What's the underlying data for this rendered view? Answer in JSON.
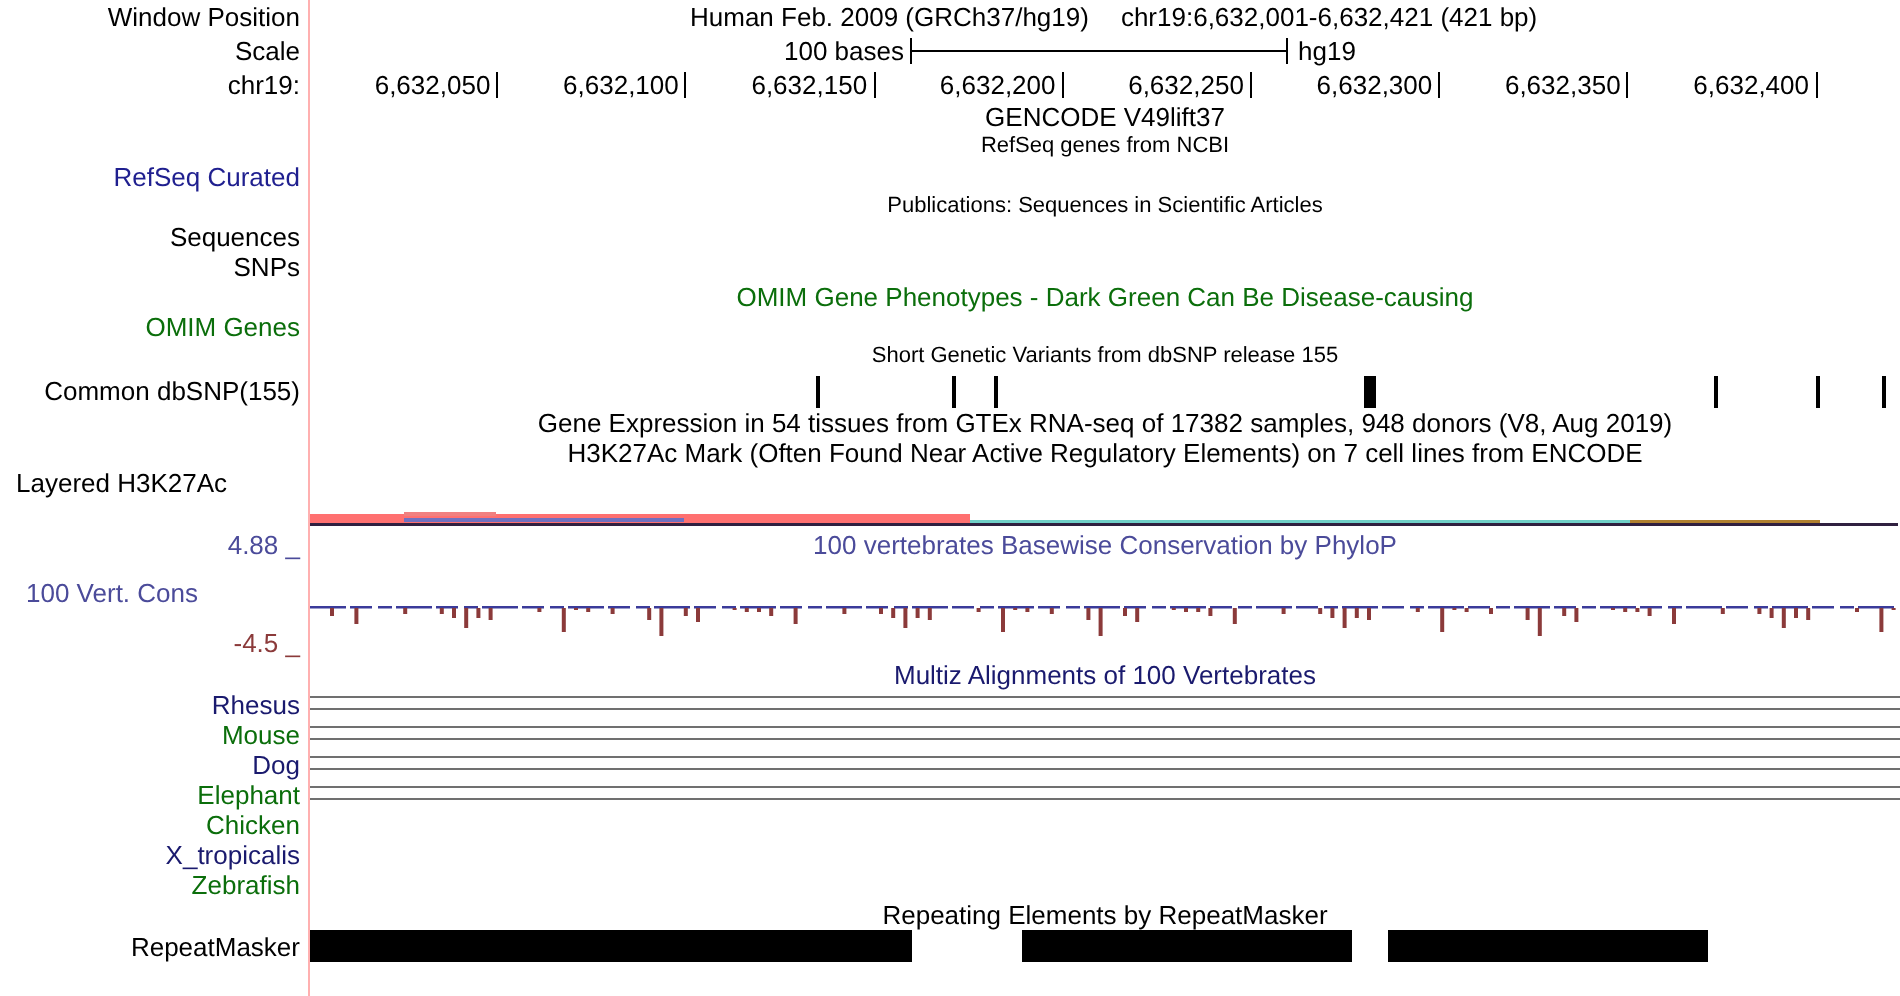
{
  "header": {
    "position_label": "Window Position",
    "assembly": "Human Feb. 2009 (GRCh37/hg19)",
    "position": "chr19:6,632,001-6,632,421 (421 bp)",
    "scale_label": "Scale",
    "scale_text": "100 bases",
    "scale_db": "hg19",
    "ruler_label": "chr19:",
    "ruler_ticks": [
      "6,632,050",
      "6,632,100",
      "6,632,150",
      "6,632,200",
      "6,632,250",
      "6,632,300",
      "6,632,350",
      "6,632,400"
    ]
  },
  "tracks": [
    {
      "kind": "title",
      "title": "GENCODE V49lift37",
      "color": "#000000"
    },
    {
      "kind": "note",
      "title": "RefSeq genes from NCBI",
      "color": "#000000"
    },
    {
      "kind": "label",
      "label": "RefSeq Curated",
      "color": "#1f1f8f"
    },
    {
      "kind": "note",
      "title": "Publications: Sequences in Scientific Articles",
      "color": "#000000"
    },
    {
      "kind": "label",
      "label": "Sequences",
      "color": "#000000"
    },
    {
      "kind": "label",
      "label": "SNPs",
      "color": "#000000"
    },
    {
      "kind": "title",
      "title": "OMIM Gene Phenotypes - Dark Green Can Be Disease-causing",
      "color": "#0b6e0b"
    },
    {
      "kind": "label",
      "label": "OMIM Genes",
      "color": "#0b6e0b"
    },
    {
      "kind": "note",
      "title": "Short Genetic Variants from dbSNP release 155",
      "color": "#000000"
    },
    {
      "kind": "snp",
      "label": "Common dbSNP(155)",
      "color": "#000000"
    },
    {
      "kind": "title",
      "title": "Gene Expression in 54 tissues from GTEx RNA-seq of 17382 samples, 948 donors (V8, Aug 2019)",
      "color": "#000000"
    },
    {
      "kind": "title",
      "title": "H3K27Ac Mark (Often Found Near Active Regulatory Elements) on 7 cell lines from ENCODE",
      "color": "#000000"
    },
    {
      "kind": "signal",
      "label": "Layered H3K27Ac",
      "color": "#000000"
    },
    {
      "kind": "conservation",
      "label": "100 Vert. Cons",
      "max": "4.88 _",
      "min": "-4.5 _",
      "title": "100 vertebrates Basewise Conservation by PhyloP",
      "color": "#4b4b9a"
    },
    {
      "kind": "title",
      "title": "Multiz Alignments of 100 Vertebrates",
      "color": "#1a1a6e"
    },
    {
      "kind": "species",
      "label": "Rhesus",
      "color": "#1a1a6e",
      "aligned": true
    },
    {
      "kind": "species",
      "label": "Mouse",
      "color": "#0b6e0b",
      "aligned": true
    },
    {
      "kind": "species",
      "label": "Dog",
      "color": "#1a1a6e",
      "aligned": true
    },
    {
      "kind": "species",
      "label": "Elephant",
      "color": "#0b6e0b",
      "aligned": true
    },
    {
      "kind": "species",
      "label": "Chicken",
      "color": "#0b6e0b",
      "aligned": false
    },
    {
      "kind": "species",
      "label": "X_tropicalis",
      "color": "#1a1a6e",
      "aligned": false
    },
    {
      "kind": "species",
      "label": "Zebrafish",
      "color": "#0b6e0b",
      "aligned": false
    },
    {
      "kind": "title",
      "title": "Repeating Elements by RepeatMasker",
      "color": "#000000"
    },
    {
      "kind": "repeats",
      "label": "RepeatMasker",
      "color": "#000000"
    }
  ]
}
